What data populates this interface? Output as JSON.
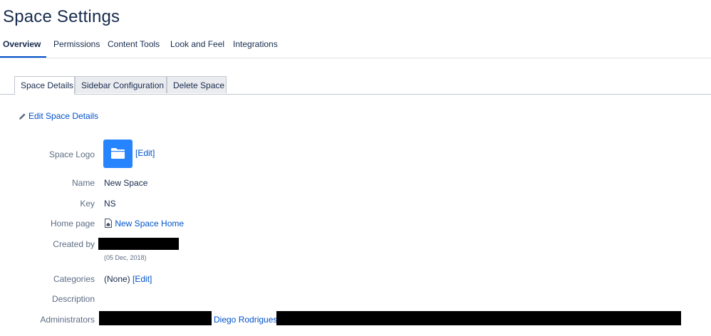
{
  "page": {
    "title": "Space Settings"
  },
  "top_tabs": [
    "Overview",
    "Permissions",
    "Content Tools",
    "Look and Feel",
    "Integrations"
  ],
  "sub_tabs": [
    "Space Details",
    "Sidebar Configuration",
    "Delete Space"
  ],
  "edit_details": {
    "label": "Edit Space Details",
    "icon": "pencil-icon"
  },
  "details": {
    "logo_label": "Space Logo",
    "logo_edit": "[Edit]",
    "logo_icon": "folder-icon",
    "name_label": "Name",
    "name_value": "New Space",
    "key_label": "Key",
    "key_value": "NS",
    "home_label": "Home page",
    "home_value": "New Space Home",
    "home_icon": "home-page-icon",
    "created_label": "Created by",
    "created_date": "(05 Dec, 2018)",
    "categories_label": "Categories",
    "categories_value": "(None)",
    "categories_edit": "[Edit]",
    "description_label": "Description",
    "admins_label": "Administrators",
    "admin_visible": "Diego Rodrigues,"
  },
  "colors": {
    "link": "#0052cc",
    "active_tab_underline": "#0052cc",
    "logo_bg": "#2684ff",
    "text": "#172b4d",
    "label": "#5e6c84"
  }
}
